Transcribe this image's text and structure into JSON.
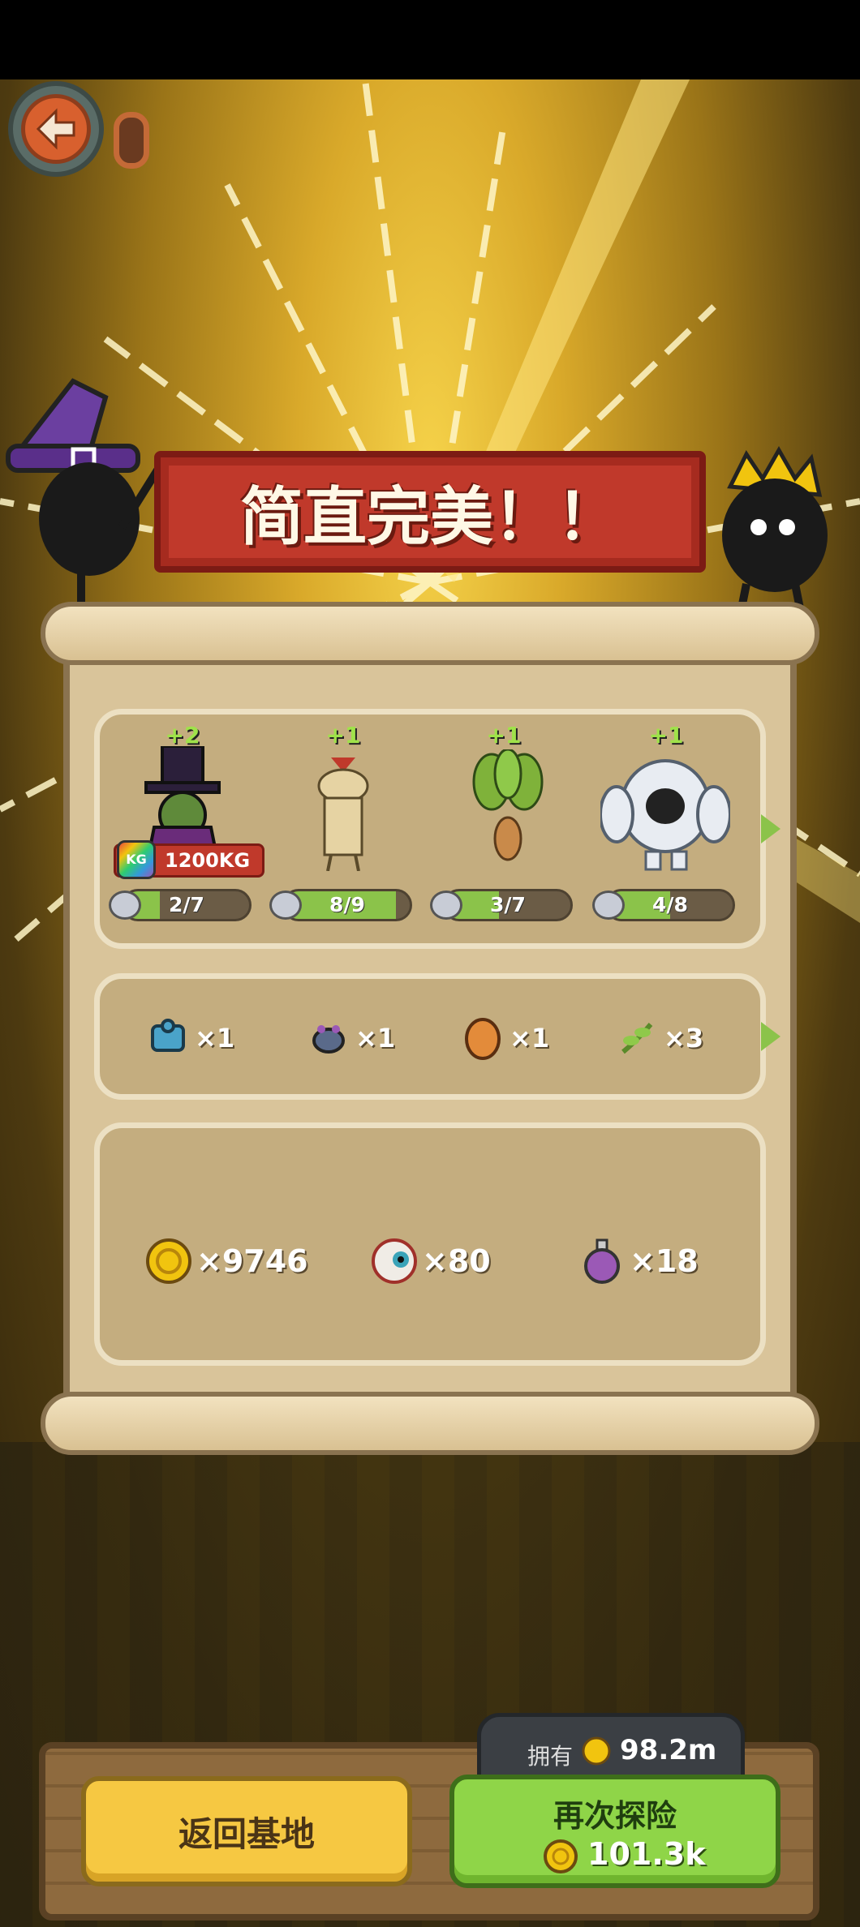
{
  "banner": {
    "title": "简直完美！！"
  },
  "monsters": [
    {
      "name": "wizard-monster",
      "plus": "+2",
      "progress": "2/7",
      "fraction": 0.2857,
      "weight": "1200KG",
      "kg_icon": "KG"
    },
    {
      "name": "straw-king-monster",
      "plus": "+1",
      "progress": "8/9",
      "fraction": 0.8889
    },
    {
      "name": "mandrake-monster",
      "plus": "+1",
      "progress": "3/7",
      "fraction": 0.4286
    },
    {
      "name": "yeti-monster",
      "plus": "+1",
      "progress": "4/8",
      "fraction": 0.5
    }
  ],
  "items": [
    {
      "icon": "blue-puzzle-icon",
      "count": "×1"
    },
    {
      "icon": "beetle-icon",
      "count": "×1"
    },
    {
      "icon": "orange-egg-icon",
      "count": "×1"
    },
    {
      "icon": "green-sprout-icon",
      "count": "×3"
    }
  ],
  "resources": [
    {
      "icon": "gold-coin-icon",
      "count": "×9746"
    },
    {
      "icon": "eyeball-icon",
      "count": "×80"
    },
    {
      "icon": "purple-potion-icon",
      "count": "×18"
    }
  ],
  "owned": {
    "label": "拥有",
    "value": "98.2m"
  },
  "buttons": {
    "back": "返回基地",
    "again": "再次探险",
    "again_cost": "101.3k"
  },
  "colors": {
    "accent_green": "#8bc34a",
    "banner_red": "#c0392b",
    "gold": "#f6c842"
  }
}
